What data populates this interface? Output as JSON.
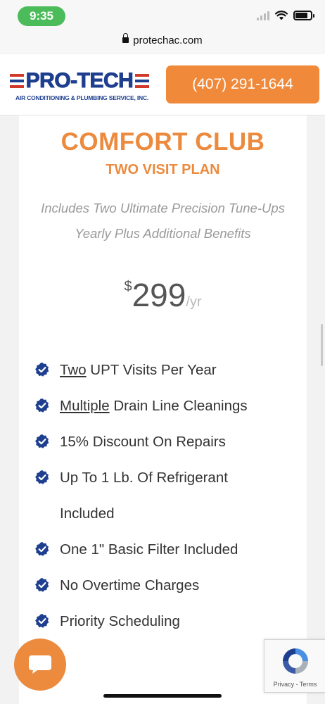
{
  "status_bar": {
    "time": "9:35"
  },
  "browser": {
    "url": "protechac.com"
  },
  "header": {
    "logo_text": "PRO-TECH",
    "logo_subtitle": "AIR CONDITIONING & PLUMBING SERVICE, INC.",
    "phone": "(407) 291-1644",
    "accent_color": "#f0893a",
    "brand_color": "#1e3f8f"
  },
  "plan": {
    "title": "COMFORT CLUB",
    "subtitle": "TWO VISIT PLAN",
    "description_line1": "Includes Two Ultimate Precision Tune-Ups",
    "description_line2": "Yearly Plus Additional Benefits",
    "currency": "$",
    "price": "299",
    "period": "/yr",
    "features": [
      {
        "emph": "Two",
        "rest": " UPT Visits Per Year"
      },
      {
        "emph": "Multiple",
        "rest": " Drain Line Cleanings"
      },
      {
        "emph": "",
        "rest": "15% Discount On Repairs"
      },
      {
        "emph": "",
        "rest": "Up To 1 Lb. Of Refrigerant Included"
      },
      {
        "emph": "",
        "rest": "One 1\" Basic Filter Included"
      },
      {
        "emph": "",
        "rest": "No Overtime Charges"
      },
      {
        "emph": "",
        "rest": "Priority Scheduling"
      }
    ]
  },
  "recaptcha": {
    "links": "Privacy - Terms"
  },
  "icons": {
    "check": "check-badge-icon",
    "chat": "chat-bubble-icon",
    "recaptcha": "recaptcha-icon",
    "lock": "lock-icon"
  }
}
